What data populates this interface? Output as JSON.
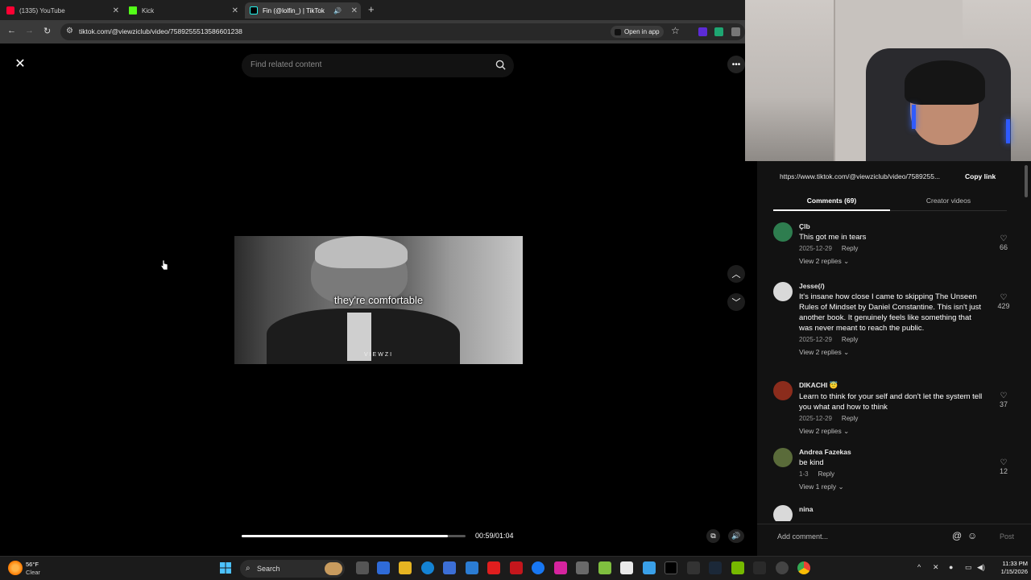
{
  "browser": {
    "tabs": [
      {
        "title": "(1335) YouTube",
        "favicon_color": "#ff0033"
      },
      {
        "title": "Kick",
        "favicon_color": "#53fc18"
      },
      {
        "title": "Fin (@lolfin_) | TikTok",
        "favicon_color": "#000000"
      }
    ],
    "url": "tiktok.com/@viewziclub/video/7589255513586601238",
    "open_in_app": "Open in app"
  },
  "viewer": {
    "search_placeholder": "Find related content",
    "caption": "they're comfortable",
    "watermark": "VIEWZI",
    "time": "00:59/01:04",
    "progress_fraction": 0.92
  },
  "panel": {
    "share_url": "https://www.tiktok.com/@viewziclub/video/7589255...",
    "copy_link": "Copy link",
    "tab_comments": "Comments (69)",
    "tab_creator": "Creator videos",
    "comments": [
      {
        "name": "Çlb",
        "text": "This got me in tears",
        "date": "2025-12-29",
        "reply": "Reply",
        "replies": "View 2 replies",
        "likes": "66",
        "avatar_color": "#2e7d4f"
      },
      {
        "name": "Jesse(/)",
        "text": "It's insane how close I came to skipping The Unseen Rules of Mindset by Daniel Constantine. This isn't just another book. It genuinely feels like something that was never meant to reach the public.",
        "date": "2025-12-29",
        "reply": "Reply",
        "replies": "View 2 replies",
        "likes": "429",
        "avatar_color": "#d9d9d9"
      },
      {
        "name": "DIKACHI 😇",
        "text": "Learn to think for your self and don't let the system tell you what and how to think",
        "date": "2025-12-29",
        "reply": "Reply",
        "replies": "View 2 replies",
        "likes": "37",
        "avatar_color": "#8b2c1c"
      },
      {
        "name": "Andrea Fazekas",
        "text": "be kind",
        "date": "1-3",
        "reply": "Reply",
        "replies": "View 1 reply",
        "likes": "12",
        "avatar_color": "#5a6b3a"
      },
      {
        "name": "nina",
        "text": "",
        "date": "",
        "reply": "",
        "replies": "",
        "likes": "",
        "avatar_color": "#d9d9d9"
      }
    ],
    "add_comment_placeholder": "Add comment...",
    "post": "Post"
  },
  "taskbar": {
    "temp": "56°F",
    "condition": "Clear",
    "search": "Search",
    "time": "11:33 PM",
    "date": "1/15/2026"
  }
}
